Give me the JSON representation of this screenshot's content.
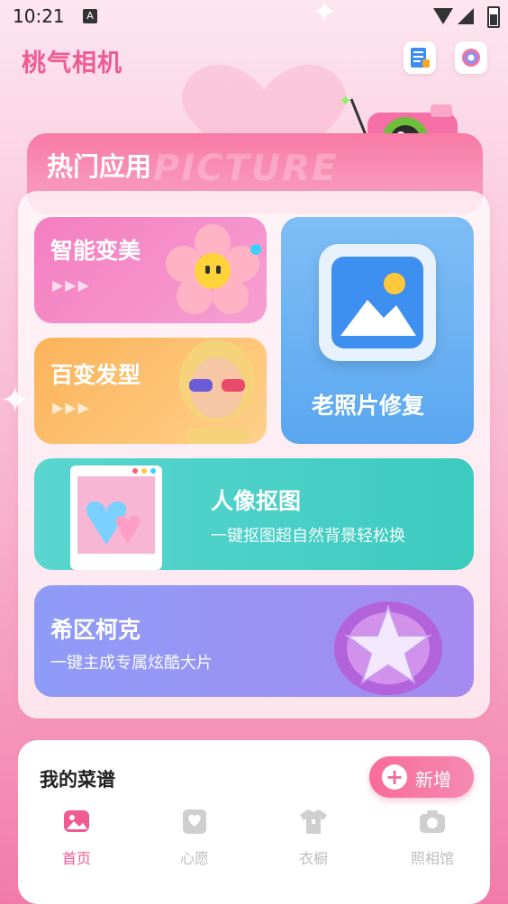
{
  "status_bar": {
    "time": "10:21",
    "notif": "A"
  },
  "header": {
    "title": "桃气相机"
  },
  "hot_apps": {
    "title": "热门应用",
    "bg_word": "PICTURE",
    "tiles": {
      "beauty": {
        "label": "智能变美",
        "arrows": "▶▶▶"
      },
      "hair": {
        "label": "百变发型",
        "arrows": "▶▶▶"
      },
      "photo_restore": {
        "label": "老照片修复"
      },
      "portrait": {
        "label": "人像抠图",
        "sub": "一键抠图超自然背景轻松换"
      },
      "cyber": {
        "label": "希区柯克",
        "sub": "一键主成专属炫酷大片"
      }
    }
  },
  "recipes": {
    "title": "我的菜谱",
    "add_label": "新增"
  },
  "nav": {
    "items": [
      {
        "label": "首页",
        "active": true
      },
      {
        "label": "心愿",
        "active": false
      },
      {
        "label": "衣橱",
        "active": false
      },
      {
        "label": "照相馆",
        "active": false
      }
    ]
  },
  "colors": {
    "accent": "#ef5b93",
    "nav_active": "#ef5b93",
    "nav_inactive": "#c8c8c8"
  }
}
